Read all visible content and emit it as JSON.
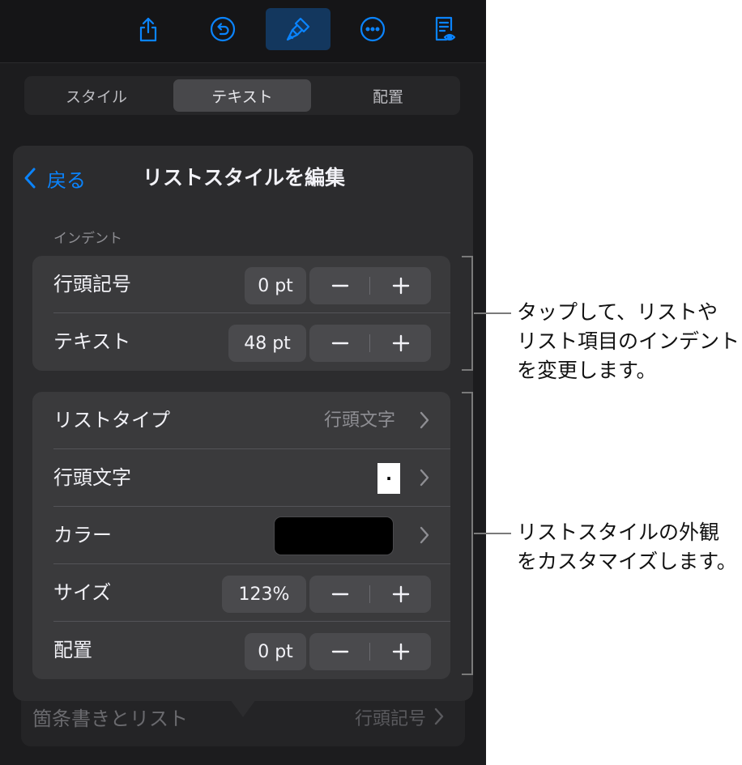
{
  "toolbar": {
    "icons": [
      "share-icon",
      "undo-icon",
      "format-brush-icon",
      "more-icon",
      "document-view-icon"
    ],
    "active": "format-brush-icon",
    "accent_color": "#0a84ff"
  },
  "tabs": [
    {
      "label": "スタイル",
      "selected": false
    },
    {
      "label": "テキスト",
      "selected": true
    },
    {
      "label": "配置",
      "selected": false
    }
  ],
  "popover": {
    "back_label": "戻る",
    "title": "リストスタイルを編集",
    "section_header": "インデント",
    "indent_rows": [
      {
        "label": "行頭記号",
        "value": "0 pt",
        "minus": "−",
        "plus": "+"
      },
      {
        "label": "テキスト",
        "value": "48 pt",
        "minus": "−",
        "plus": "+"
      }
    ],
    "style_rows": {
      "list_type": {
        "label": "リストタイプ",
        "value": "行頭文字"
      },
      "bullet": {
        "label": "行頭文字",
        "glyph": "·"
      },
      "color": {
        "label": "カラー",
        "swatch_color": "#000000"
      },
      "size": {
        "label": "サイズ",
        "value": "123%"
      },
      "alignment": {
        "label": "配置",
        "value": "0 pt"
      }
    }
  },
  "underlying_row": {
    "label": "箇条書きとリスト",
    "value": "行頭記号"
  },
  "callouts": [
    {
      "lines": [
        "タップして、リストや",
        "リスト項目のインデント",
        "を変更します。"
      ]
    },
    {
      "lines": [
        "リストスタイルの外観",
        "をカスタマイズします。"
      ]
    }
  ]
}
